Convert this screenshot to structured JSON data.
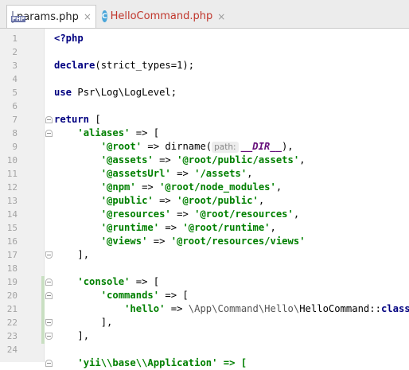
{
  "tabs": [
    {
      "label": "params.php",
      "icon": "php-file-icon",
      "active": true,
      "modified": false
    },
    {
      "label": "HelloCommand.php",
      "icon": "php-class-icon",
      "active": false,
      "modified": true
    }
  ],
  "close_glyph": "×",
  "php_icon_text": "PHP",
  "class_icon_text": "C",
  "lines": [
    {
      "n": "1"
    },
    {
      "n": "2"
    },
    {
      "n": "3"
    },
    {
      "n": "4"
    },
    {
      "n": "5"
    },
    {
      "n": "6"
    },
    {
      "n": "7"
    },
    {
      "n": "8"
    },
    {
      "n": "9"
    },
    {
      "n": "10"
    },
    {
      "n": "11"
    },
    {
      "n": "12"
    },
    {
      "n": "13"
    },
    {
      "n": "14"
    },
    {
      "n": "15"
    },
    {
      "n": "16"
    },
    {
      "n": "17"
    },
    {
      "n": "18"
    },
    {
      "n": "19"
    },
    {
      "n": "20"
    },
    {
      "n": "21"
    },
    {
      "n": "22"
    },
    {
      "n": "23"
    },
    {
      "n": "24"
    }
  ],
  "code": {
    "l1": "<?php",
    "l3_kw": "declare",
    "l3_rest": "(strict_types=1);",
    "l5_kw": "use",
    "l5_rest": " Psr\\Log\\LogLevel;",
    "l7_kw": "return",
    "l7_rest": " [",
    "l8_str": "'aliases'",
    "l8_rest": " => [",
    "l9_str": "'@root'",
    "l9_mid": " => dirname(",
    "l9_hint": "path:",
    "l9_const": "__DIR__",
    "l9_end": "),",
    "l10_str1": "'@assets'",
    "l10_mid": " => ",
    "l10_str2": "'@root/public/assets'",
    "l10_end": ",",
    "l11_str1": "'@assetsUrl'",
    "l11_mid": " => ",
    "l11_str2": "'/assets'",
    "l11_end": ",",
    "l12_str1": "'@npm'",
    "l12_mid": " => ",
    "l12_str2": "'@root/node_modules'",
    "l12_end": ",",
    "l13_str1": "'@public'",
    "l13_mid": " => ",
    "l13_str2": "'@root/public'",
    "l13_end": ",",
    "l14_str1": "'@resources'",
    "l14_mid": " => ",
    "l14_str2": "'@root/resources'",
    "l14_end": ",",
    "l15_str1": "'@runtime'",
    "l15_mid": " => ",
    "l15_str2": "'@root/runtime'",
    "l15_end": ",",
    "l16_str1": "'@views'",
    "l16_mid": " => ",
    "l16_str2": "'@root/resources/views'",
    "l17": "],",
    "l19_str": "'console'",
    "l19_rest": " => [",
    "l20_str": "'commands'",
    "l20_rest": " => [",
    "l21_str": "'hello'",
    "l21_mid": " => ",
    "l21_ns": "\\App\\Command\\Hello\\",
    "l21_cls": "HelloCommand::",
    "l21_kw": "class",
    "l21_end": ",",
    "l22": "],",
    "l23": "],",
    "l24_partial": "'yii\\\\base\\\\Application' => ["
  },
  "colors": {
    "keyword": "#000080",
    "string": "#008000",
    "constant": "#660e7a",
    "modified_tab": "#c0362c",
    "change_marker": "#c9dfc2"
  }
}
